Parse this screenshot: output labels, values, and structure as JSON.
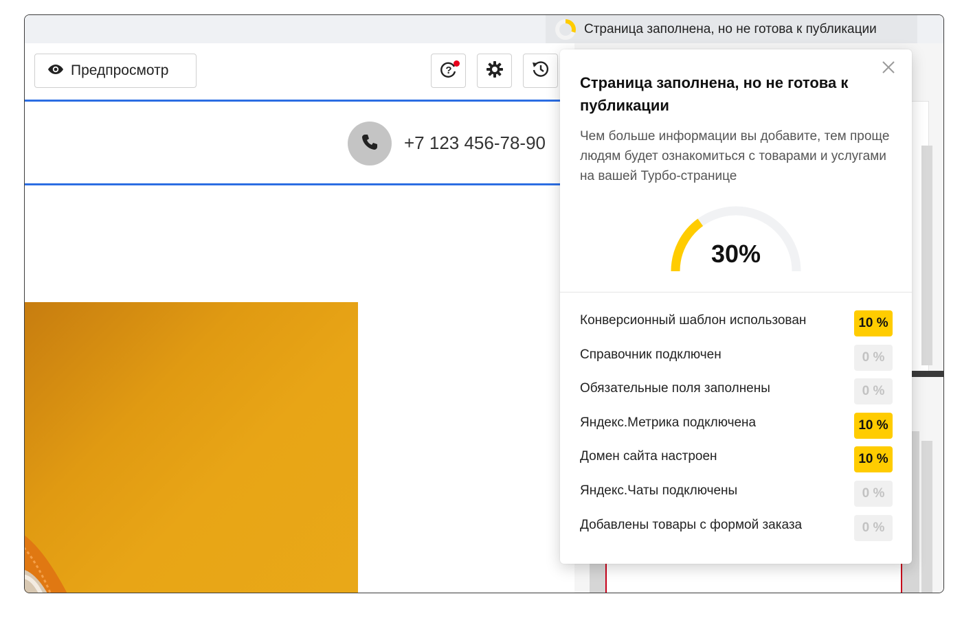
{
  "status_bar": {
    "text": "Страница заполнена, но не готова к публикации",
    "progress_percent": 30
  },
  "toolbar": {
    "preview_label": "Предпросмотр",
    "help_icon": "help-icon",
    "settings_icon": "gear-icon",
    "history_icon": "history-icon",
    "notification_dot_color": "#e8001c"
  },
  "page_preview": {
    "phone": "+7 123 456-78-90",
    "accent_line_color": "#2b6de3",
    "hero_color": "#e09a12"
  },
  "popup": {
    "title": "Страница заполнена, но не готова к публикации",
    "description": "Чем больше информации вы добавите, тем проще людям будет ознакомиться с товарами и услугами на вашей Турбо-странице",
    "progress_label": "30%",
    "progress_value": 30,
    "accent_color": "#ffcc00",
    "criteria": [
      {
        "label": "Конверсионный шаблон использован",
        "percent": "10 %",
        "done": true
      },
      {
        "label": "Справочник подключен",
        "percent": "0 %",
        "done": false
      },
      {
        "label": "Обязательные поля заполнены",
        "percent": "0 %",
        "done": false
      },
      {
        "label": "Яндекс.Метрика подключена",
        "percent": "10 %",
        "done": true
      },
      {
        "label": "Домен сайта настроен",
        "percent": "10 %",
        "done": true
      },
      {
        "label": "Яндекс.Чаты подключены",
        "percent": "0 %",
        "done": false
      },
      {
        "label": "Добавлены товары с формой заказа",
        "percent": "0 %",
        "done": false
      }
    ]
  }
}
